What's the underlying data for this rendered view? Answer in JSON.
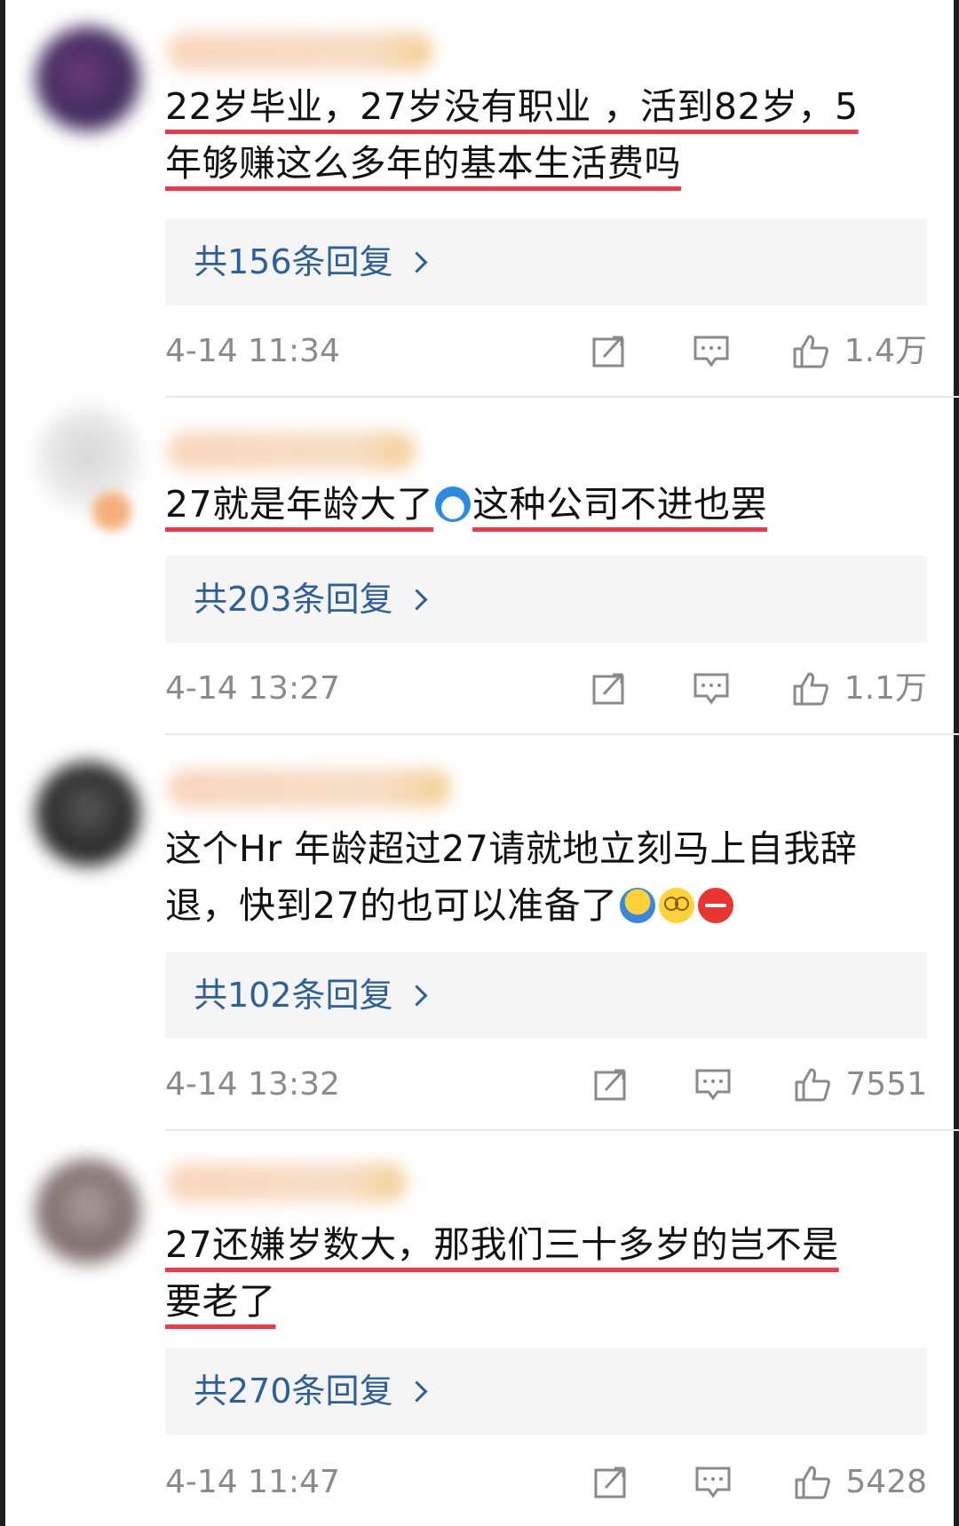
{
  "comments": [
    {
      "lines": [
        "22岁毕业，27岁没有职业 ，活到82岁，5",
        "年够赚这么多年的基本生活费吗"
      ],
      "underlined": true,
      "replies": "共156条回复",
      "time": "4-14 11:34",
      "likes": "1.4万"
    },
    {
      "lines": [
        "27就是年龄大了",
        "这种公司不进也罢"
      ],
      "underlined": true,
      "replies": "共203条回复",
      "time": "4-14 13:27",
      "likes": "1.1万"
    },
    {
      "lines": [
        "这个Hr 年龄超过27请就地立刻马上自我辞",
        "退，快到27的也可以准备了"
      ],
      "underlined": false,
      "replies": "共102条回复",
      "time": "4-14 13:32",
      "likes": "7551"
    },
    {
      "lines": [
        "27还嫌岁数大，那我们三十多岁的岂不是",
        "要老了"
      ],
      "underlined": true,
      "replies": "共270条回复",
      "time": "4-14 11:47",
      "likes": "5428"
    }
  ],
  "icons": {
    "share": "share-icon",
    "comment": "comment-icon",
    "like": "thumbs-up-icon",
    "emoji_doraemon": "doraemon-emoji",
    "emoji_shrug": "shrug-emoji",
    "emoji_dizzy": "dizzy-emoji",
    "emoji_angry": "angry-emoji"
  },
  "colors": {
    "underline": "#f03a4a",
    "reply_link": "#2d5f9a",
    "meta_text": "#8a8a8a",
    "reply_bg": "#f5f5f5"
  }
}
